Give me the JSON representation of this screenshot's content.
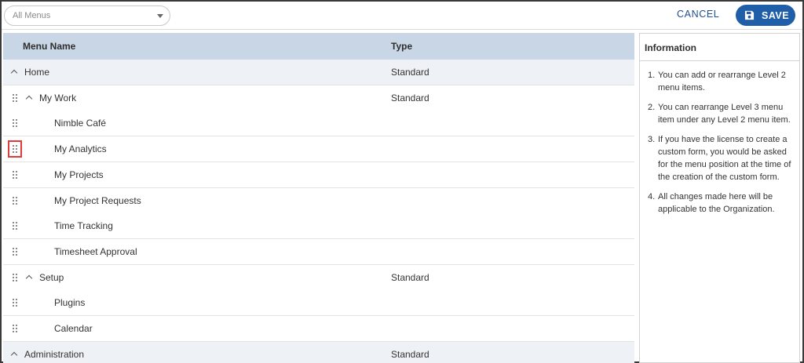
{
  "toolbar": {
    "menu_filter": {
      "value": "All Menus"
    },
    "cancel_label": "CANCEL",
    "save_label": "SAVE",
    "accent": "#1f5ea8"
  },
  "table": {
    "columns": [
      "Menu Name",
      "Type"
    ],
    "rows": [
      {
        "name": "Home",
        "type": "Standard",
        "level": 1,
        "expanded": true,
        "draggable": false
      },
      {
        "name": "My Work",
        "type": "Standard",
        "level": 2,
        "expanded": true,
        "draggable": true
      },
      {
        "name": "Nimble Café",
        "type": "",
        "level": 3,
        "draggable": true
      },
      {
        "name": "My Analytics",
        "type": "",
        "level": 3,
        "draggable": true,
        "highlighted": true
      },
      {
        "name": "My Projects",
        "type": "",
        "level": 3,
        "draggable": true
      },
      {
        "name": "My Project Requests",
        "type": "",
        "level": 3,
        "draggable": true
      },
      {
        "name": "Time Tracking",
        "type": "",
        "level": 3,
        "draggable": true
      },
      {
        "name": "Timesheet Approval",
        "type": "",
        "level": 3,
        "draggable": true
      },
      {
        "name": "Setup",
        "type": "Standard",
        "level": 2,
        "expanded": true,
        "draggable": true
      },
      {
        "name": "Plugins",
        "type": "",
        "level": 3,
        "draggable": true
      },
      {
        "name": "Calendar",
        "type": "",
        "level": 3,
        "draggable": true
      },
      {
        "name": "Administration",
        "type": "Standard",
        "level": 1,
        "expanded": true,
        "draggable": false
      }
    ]
  },
  "info": {
    "title": "Information",
    "items": [
      {
        "num": "1.",
        "text": "You can add or rearrange Level 2 menu items."
      },
      {
        "num": "2.",
        "text": "You can rearrange Level 3 menu item under any Level 2 menu item."
      },
      {
        "num": "3.",
        "text": "If you have the license to create a custom form, you would be asked for the menu position at the time of the creation of the custom form."
      },
      {
        "num": "4.",
        "text": "All changes made here will be applicable to the Organization."
      }
    ]
  }
}
